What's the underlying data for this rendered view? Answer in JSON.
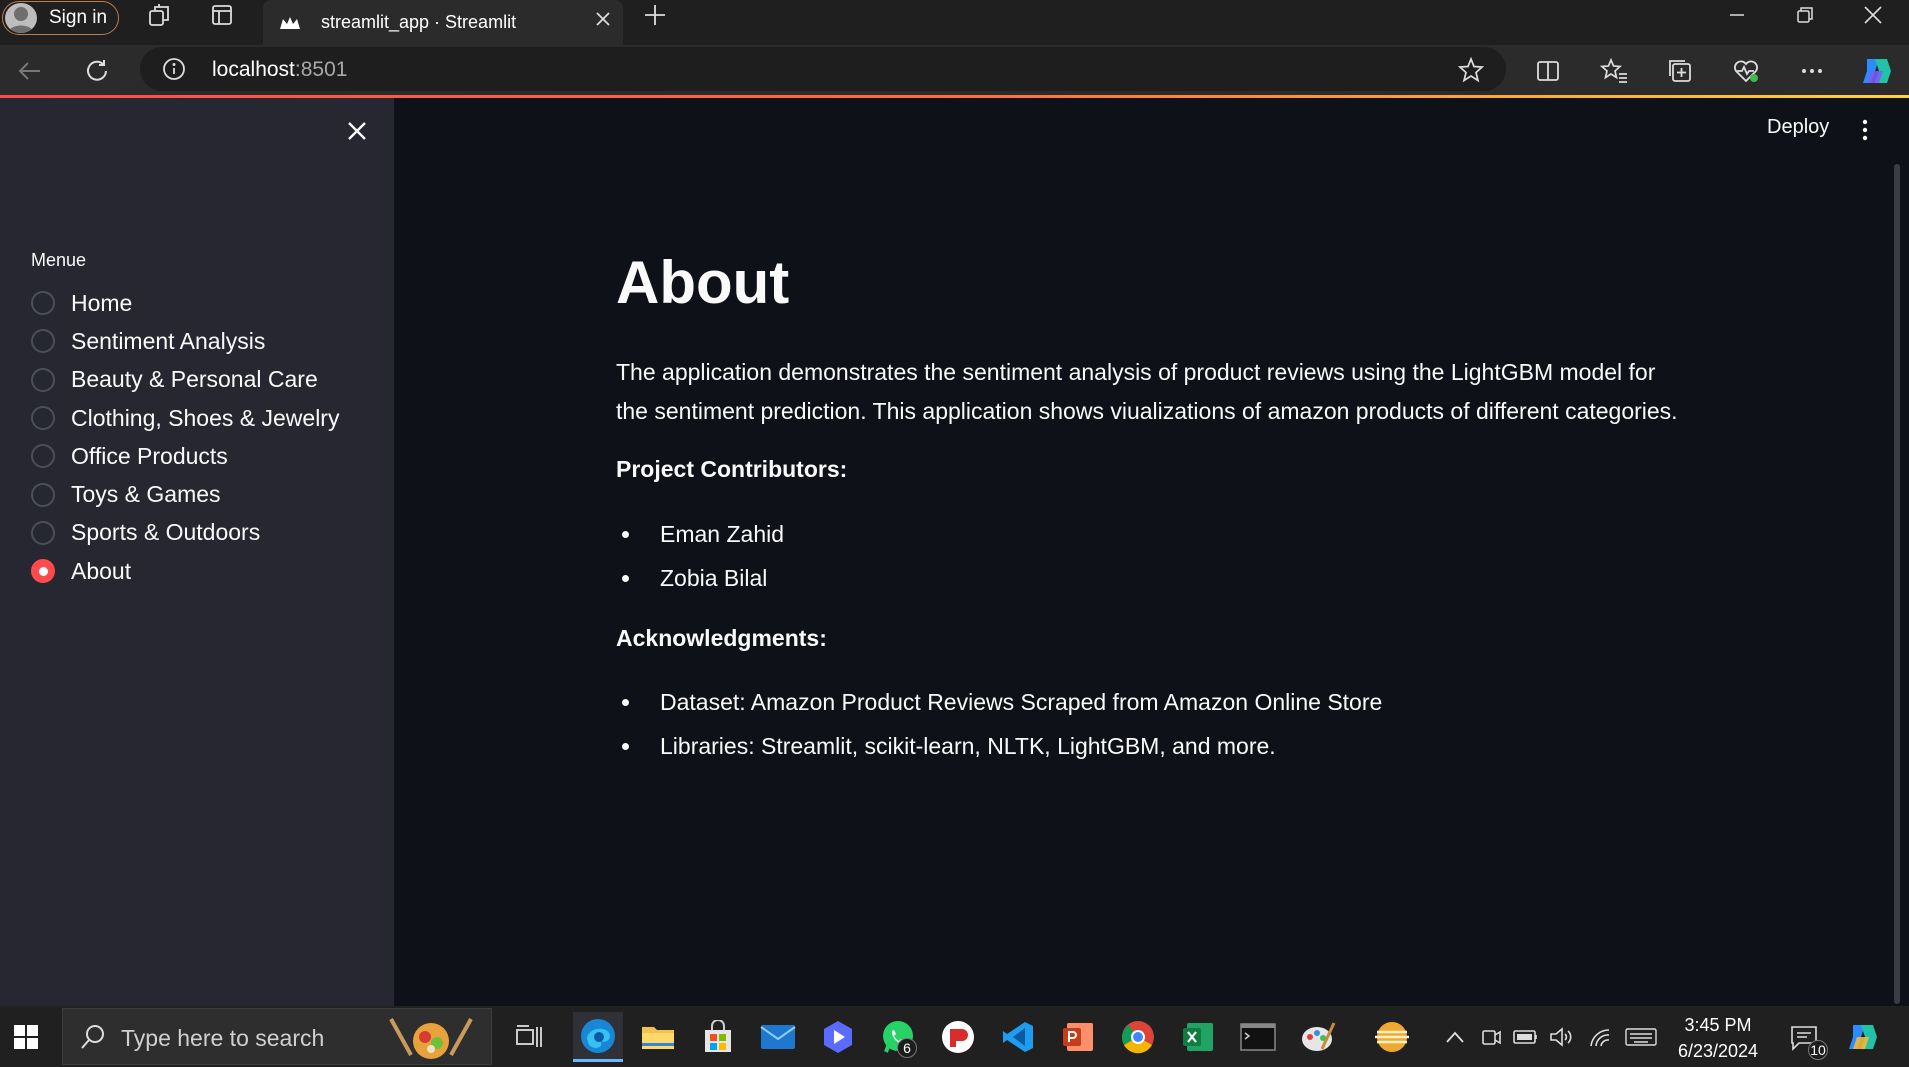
{
  "browser": {
    "sign_in_label": "Sign in",
    "tab_title": "streamlit_app · Streamlit",
    "url_host": "localhost",
    "url_port": ":8501"
  },
  "streamlit": {
    "deploy_label": "Deploy"
  },
  "sidebar": {
    "menu_title": "Menue",
    "items": [
      {
        "label": "Home",
        "selected": false
      },
      {
        "label": "Sentiment Analysis",
        "selected": false
      },
      {
        "label": "Beauty & Personal Care",
        "selected": false
      },
      {
        "label": "Clothing, Shoes & Jewelry",
        "selected": false
      },
      {
        "label": "Office Products",
        "selected": false
      },
      {
        "label": "Toys & Games",
        "selected": false
      },
      {
        "label": "Sports & Outdoors",
        "selected": false
      },
      {
        "label": "About",
        "selected": true
      }
    ]
  },
  "main": {
    "title": "About",
    "intro_line1": "The application demonstrates the sentiment analysis of product reviews using the LightGBM model for",
    "intro_line2": "the sentiment prediction. This application shows viualizations of amazon products of different categories.",
    "contributors_heading": "Project Contributors:",
    "contributors": [
      "Eman Zahid",
      "Zobia Bilal"
    ],
    "acknowledgments_heading": "Acknowledgments:",
    "acknowledgments": [
      "Dataset: Amazon Product Reviews Scraped from Amazon Online Store",
      "Libraries: Streamlit, scikit-learn, NLTK, LightGBM, and more."
    ]
  },
  "taskbar": {
    "search_placeholder": "Type here to search",
    "whatsapp_badge": "6",
    "time": "3:45 PM",
    "date": "6/23/2024",
    "notification_count": "10"
  },
  "colors": {
    "accent": "#ff4b4b",
    "sidebar_bg": "#262730",
    "main_bg": "#0e1117"
  }
}
